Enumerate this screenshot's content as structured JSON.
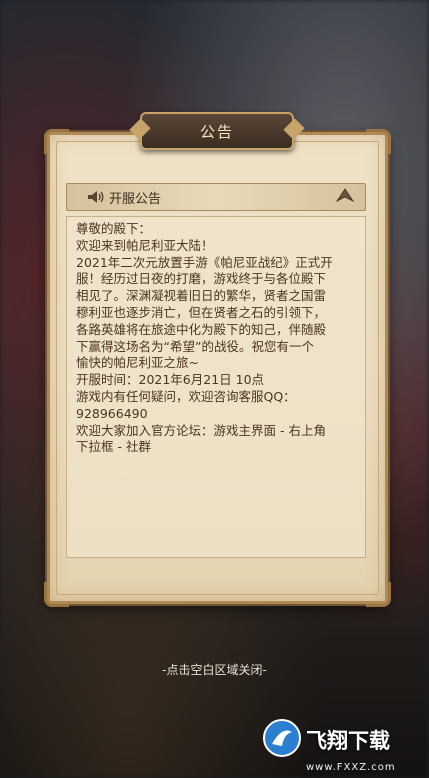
{
  "dialog": {
    "title": "公告",
    "section_title": "开服公告",
    "lines": [
      "尊敬的殿下：",
      "欢迎来到帕尼利亚大陆！",
      "2021年二次元放置手游《帕尼亚战纪》正式开",
      "服！经历过日夜的打磨，游戏终于与各位殿下",
      "相见了。深渊凝视着旧日的繁华，贤者之国雷",
      "穆利亚也逐步消亡，但在贤者之石的引领下，",
      "各路英雄将在旅途中化为殿下的知己，伴随殿",
      "下赢得这场名为“希望”的战役。祝您有一个",
      "愉快的帕尼利亚之旅~",
      "开服时间：2021年6月21日 10点",
      "游戏内有任何疑问，欢迎咨询客服QQ：",
      "928966490",
      "欢迎大家加入官方论坛：游戏主界面 - 右上角",
      "下拉框 - 社群"
    ]
  },
  "close_hint": "-点击空白区域关闭-",
  "watermark": {
    "text": "飞翔下载",
    "url": "www.FXXZ.com"
  },
  "icons": {
    "speaker": "speaker-icon",
    "collapse": "collapse-arrow-icon",
    "logo": "watermark-logo-icon"
  },
  "colors": {
    "panel": "#efe2c6",
    "frame": "#b08a55",
    "text": "#4a3523",
    "title_plate": "#3c2d22"
  }
}
